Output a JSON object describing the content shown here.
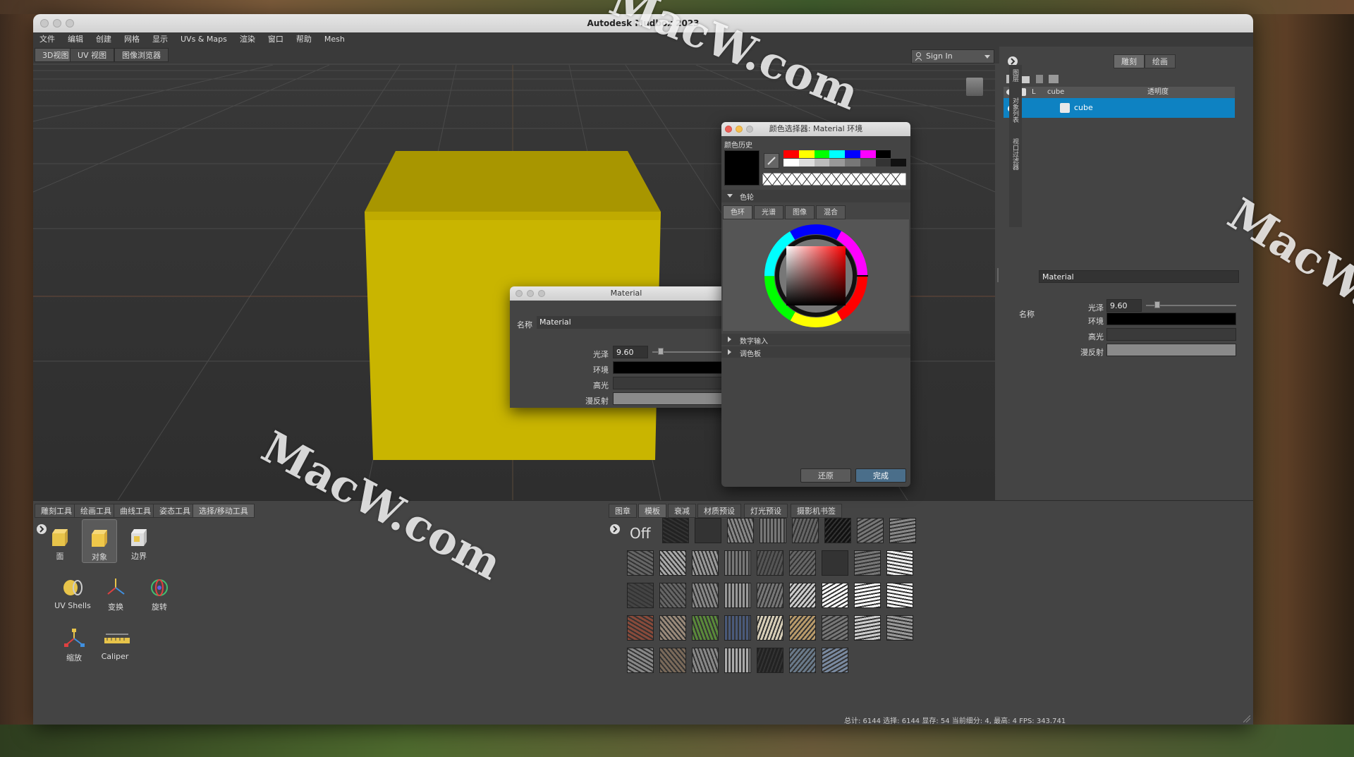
{
  "window": {
    "title": "Autodesk Mudbox 2023"
  },
  "menu": [
    "文件",
    "编辑",
    "创建",
    "网格",
    "显示",
    "UVs & Maps",
    "渲染",
    "窗口",
    "帮助",
    "Mesh"
  ],
  "view_tabs": [
    "3D视图",
    "UV 视图",
    "图像浏览器"
  ],
  "signin": {
    "label": "Sign In"
  },
  "right_panel": {
    "tabs": [
      "雕刻",
      "绘画"
    ],
    "layer_header": {
      "lock": "L",
      "name": "cube",
      "opacity": "透明度"
    },
    "layer_row": {
      "name": "cube"
    },
    "side_labels": [
      "图层",
      "对象列表",
      "视口过滤器"
    ],
    "name_label": "名称",
    "name_value": "Material",
    "gloss_label": "光泽",
    "gloss_value": "9.60",
    "gloss_fraction": 0.1,
    "ambient_label": "环境",
    "specular_label": "高光",
    "diffuse_label": "漫反射"
  },
  "material_dialog": {
    "title": "Material",
    "name_label": "名称",
    "name_value": "Material",
    "gloss_label": "光泽",
    "gloss_value": "9.60",
    "ambient_label": "环境",
    "specular_label": "高光",
    "diffuse_label": "漫反射"
  },
  "color_picker": {
    "title": "颜色选择器: Material 环境",
    "history_label": "颜色历史",
    "wheel_section": "色轮",
    "tabs": [
      "色环",
      "光谱",
      "图像",
      "混合"
    ],
    "numeric_input": "数字输入",
    "palette": "调色板",
    "reset_button": "还原",
    "done_button": "完成",
    "swatch_colors": [
      "#ff0000",
      "#ffff00",
      "#00ff00",
      "#00ffff",
      "#0000ff",
      "#ff00ff",
      "#000000"
    ],
    "swatch_grays": [
      "#ffffff",
      "#dddddd",
      "#bbbbbb",
      "#999999",
      "#777777",
      "#555555",
      "#333333",
      "#111111"
    ]
  },
  "tool_tabs": [
    "雕刻工具",
    "绘画工具",
    "曲线工具",
    "姿态工具",
    "选择/移动工具"
  ],
  "tools": [
    "面",
    "对象",
    "边界",
    "UV Shells",
    "变换",
    "旋转",
    "缩放",
    "Caliper"
  ],
  "stamp_tabs": [
    "图章",
    "模板",
    "衰减",
    "材质预设",
    "灯光预设",
    "摄影机书签"
  ],
  "stamp_off": "Off",
  "status": "总计: 6144  选择: 6144 显存: 54  当前细分: 4, 最高: 4  FPS: 343.741",
  "watermark": "MacW.com",
  "colors": {
    "cube": "#c9b500",
    "selection": "#0e82c2",
    "panel": "#444444"
  }
}
